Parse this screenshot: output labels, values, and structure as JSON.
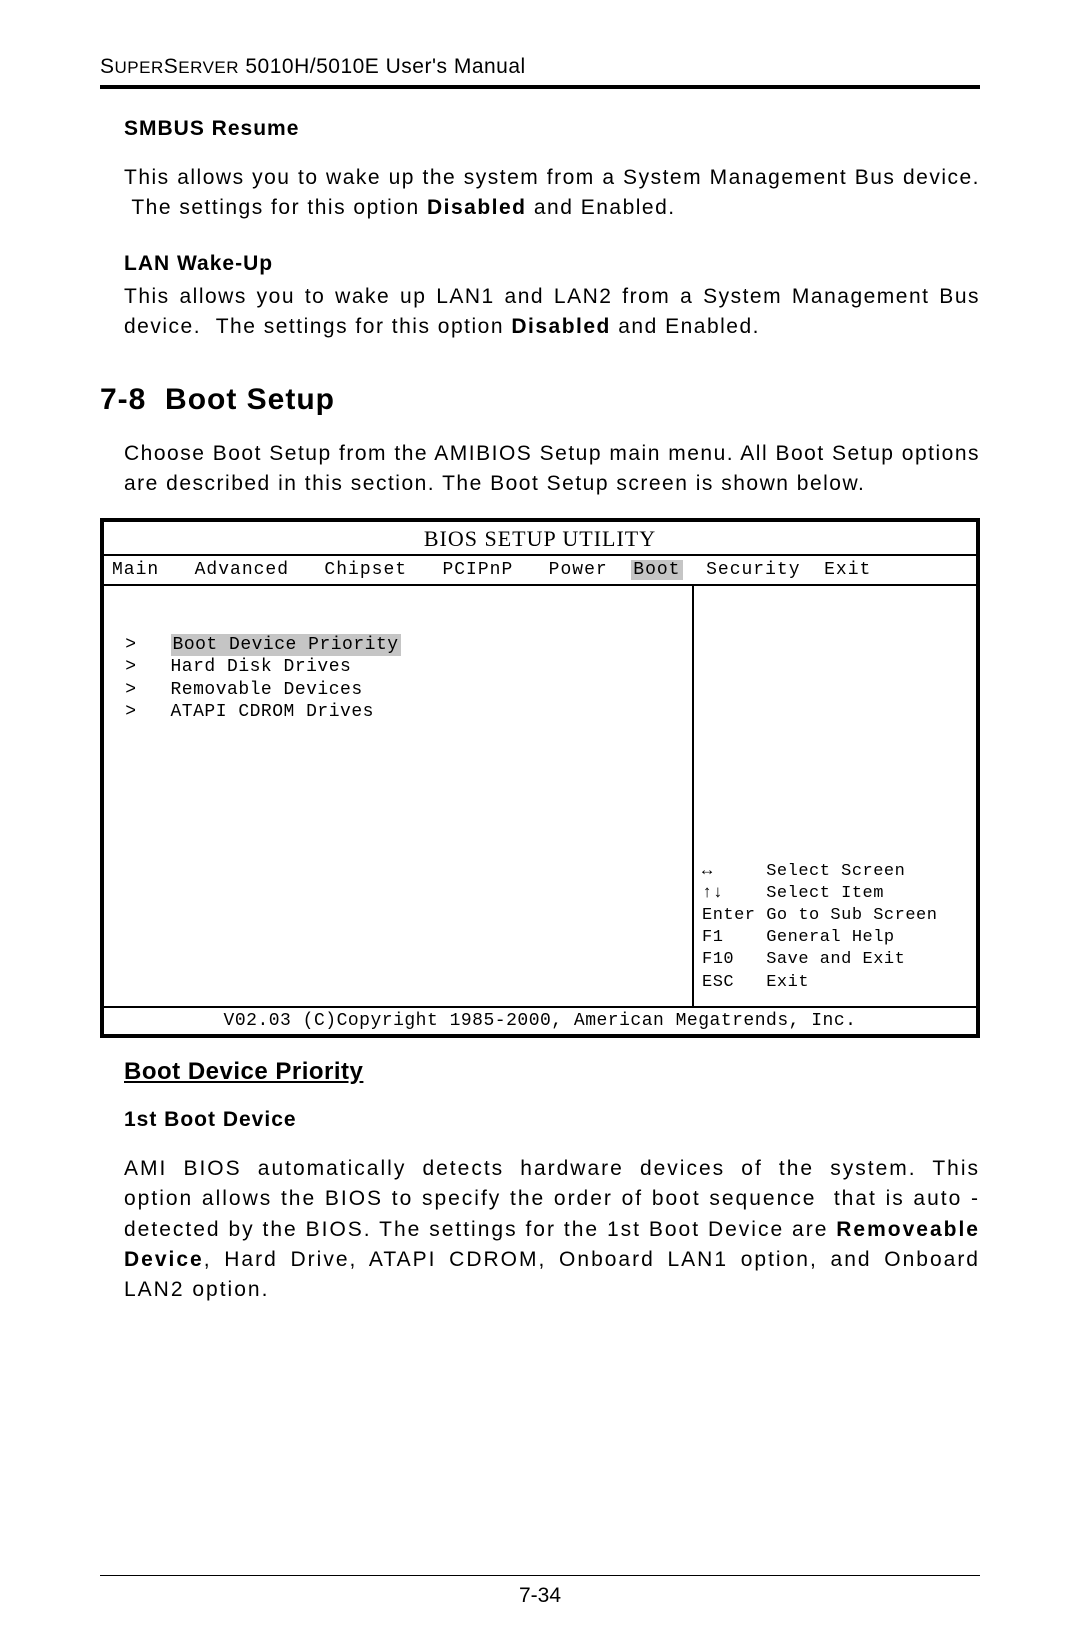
{
  "header": "SUPERSERVER 5010H/5010E User's Manual",
  "smbus": {
    "title": "SMBUS Resume",
    "text": "This allows you to wake up the system from a System Management Bus device.  The settings for this option Disabled and Enabled."
  },
  "lan": {
    "title": "LAN Wake-Up",
    "text": "This allows you to wake up LAN1 and LAN2 from a System Management Bus device.  The settings for this option Disabled and Enabled."
  },
  "section": {
    "num": "7-8",
    "title": "Boot Setup",
    "intro": "Choose Boot Setup from the AMIBIOS Setup main menu.  All Boot Setup options are described in this section.  The Boot Setup screen is shown below."
  },
  "bios": {
    "title": "BIOS SETUP UTILITY",
    "tabs": [
      "Main",
      "Advanced",
      "Chipset",
      "PCIPnP",
      "Power",
      "Boot",
      "Security",
      "Exit"
    ],
    "selectedTab": "Boot",
    "items": [
      "Boot Device Priority",
      "Hard Disk Drives",
      "Removable Devices",
      "ATAPI CDROM Drives"
    ],
    "help": [
      {
        "key": "↔",
        "label": "Select Screen"
      },
      {
        "key": "↑↓",
        "label": "Select Item"
      },
      {
        "key": "Enter",
        "label": "Go to Sub Screen"
      },
      {
        "key": "F1",
        "label": "General Help"
      },
      {
        "key": "F10",
        "label": "Save and Exit"
      },
      {
        "key": "ESC",
        "label": "Exit"
      }
    ],
    "footer": "V02.03 (C)Copyright 1985-2000, American Megatrends, Inc."
  },
  "bootPriority": {
    "title": "Boot Device Priority",
    "firstTitle": "1st Boot Device",
    "firstText": "AMI BIOS automatically detects hardware devices of the system. This option allows the BIOS to specify the order of boot sequence  that is auto - detected by the BIOS. The settings for the 1st Boot Device are Removeable Device, Hard Drive, ATAPI CDROM, Onboard LAN1 option, and Onboard LAN2 option."
  },
  "pageNum": "7-34"
}
